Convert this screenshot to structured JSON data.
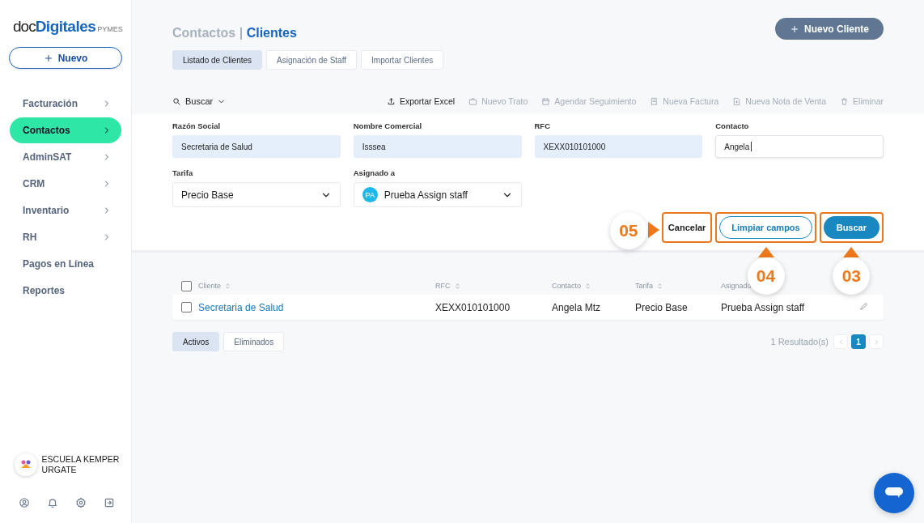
{
  "sidebar": {
    "logo": {
      "prefix": "doc",
      "main": "Digitales",
      "suffix": "PYMES"
    },
    "new_button": "Nuevo",
    "items": [
      {
        "label": "Facturación",
        "selected": false,
        "expandable": true
      },
      {
        "label": "Contactos",
        "selected": true,
        "expandable": true
      },
      {
        "label": "AdminSAT",
        "selected": false,
        "expandable": true
      },
      {
        "label": "CRM",
        "selected": false,
        "expandable": true
      },
      {
        "label": "Inventario",
        "selected": false,
        "expandable": true
      },
      {
        "label": "RH",
        "selected": false,
        "expandable": true
      },
      {
        "label": "Pagos en Línea",
        "selected": false,
        "expandable": false
      },
      {
        "label": "Reportes",
        "selected": false,
        "expandable": false
      }
    ],
    "account": {
      "name": "ESCUELA KEMPER URGATE"
    }
  },
  "header": {
    "breadcrumb_parent": "Contactos",
    "separator": "|",
    "breadcrumb_current": "Clientes",
    "primary_button": "Nuevo Cliente",
    "tabs": [
      {
        "label": "Listado de Clientes",
        "selected": true
      },
      {
        "label": "Asignación de Staff",
        "selected": false
      },
      {
        "label": "Importar Clientes",
        "selected": false
      }
    ]
  },
  "toolbar": {
    "search_menu": "Buscar",
    "actions": [
      {
        "kind": "export",
        "label": "Exportar Excel",
        "disabled": false
      },
      {
        "kind": "deal",
        "label": "Nuevo Trato",
        "disabled": true
      },
      {
        "kind": "calendar",
        "label": "Agendar Seguimiento",
        "disabled": true
      },
      {
        "kind": "invoice",
        "label": "Nueva Factura",
        "disabled": true
      },
      {
        "kind": "note",
        "label": "Nueva Nota de Venta",
        "disabled": true
      },
      {
        "kind": "delete",
        "label": "Eliminar",
        "disabled": true
      }
    ]
  },
  "filters": {
    "fields": [
      {
        "kind": "text",
        "label": "Razón Social",
        "value": "Secretaria de Salud",
        "highlighted": true,
        "focused": false
      },
      {
        "kind": "text",
        "label": "Nombre Comercial",
        "value": "Isssea",
        "highlighted": true,
        "focused": false
      },
      {
        "kind": "text",
        "label": "RFC",
        "value": "XEXX010101000",
        "highlighted": true,
        "focused": false
      },
      {
        "kind": "text",
        "label": "Contacto",
        "value": "Angela",
        "highlighted": false,
        "focused": true
      },
      {
        "kind": "select",
        "label": "Tarifa",
        "value": "Precio Base"
      },
      {
        "kind": "select",
        "label": "Asignado a",
        "value": "Prueba Assign staff",
        "avatar_initials": "PA"
      }
    ],
    "buttons": [
      {
        "kind": "text",
        "label": "Cancelar",
        "highlighted": true,
        "callout": "05"
      },
      {
        "kind": "outline",
        "label": "Limpiar campos",
        "highlighted": true,
        "callout": "04"
      },
      {
        "kind": "primary",
        "label": "Buscar",
        "highlighted": true,
        "callout": "03"
      }
    ]
  },
  "table": {
    "select_all": {
      "checked": false
    },
    "columns": [
      {
        "label": "Cliente",
        "sortable": true
      },
      {
        "label": "RFC",
        "sortable": true
      },
      {
        "label": "Contacto",
        "sortable": true
      },
      {
        "label": "Tarifa",
        "sortable": true
      },
      {
        "label": "Asignado",
        "sortable": false
      }
    ],
    "rows": [
      {
        "checked": false,
        "cells": [
          "Secretaria de Salud",
          "XEXX010101000",
          "Angela Mtz",
          "Precio Base",
          "Prueba Assign staff"
        ]
      }
    ]
  },
  "footer": {
    "status_tabs": [
      {
        "label": "Activos",
        "selected": true
      },
      {
        "label": "Eliminados",
        "selected": false
      }
    ],
    "result_count": "1 Resultado(s)",
    "pages": [
      {
        "label": "1",
        "selected": true
      }
    ]
  }
}
